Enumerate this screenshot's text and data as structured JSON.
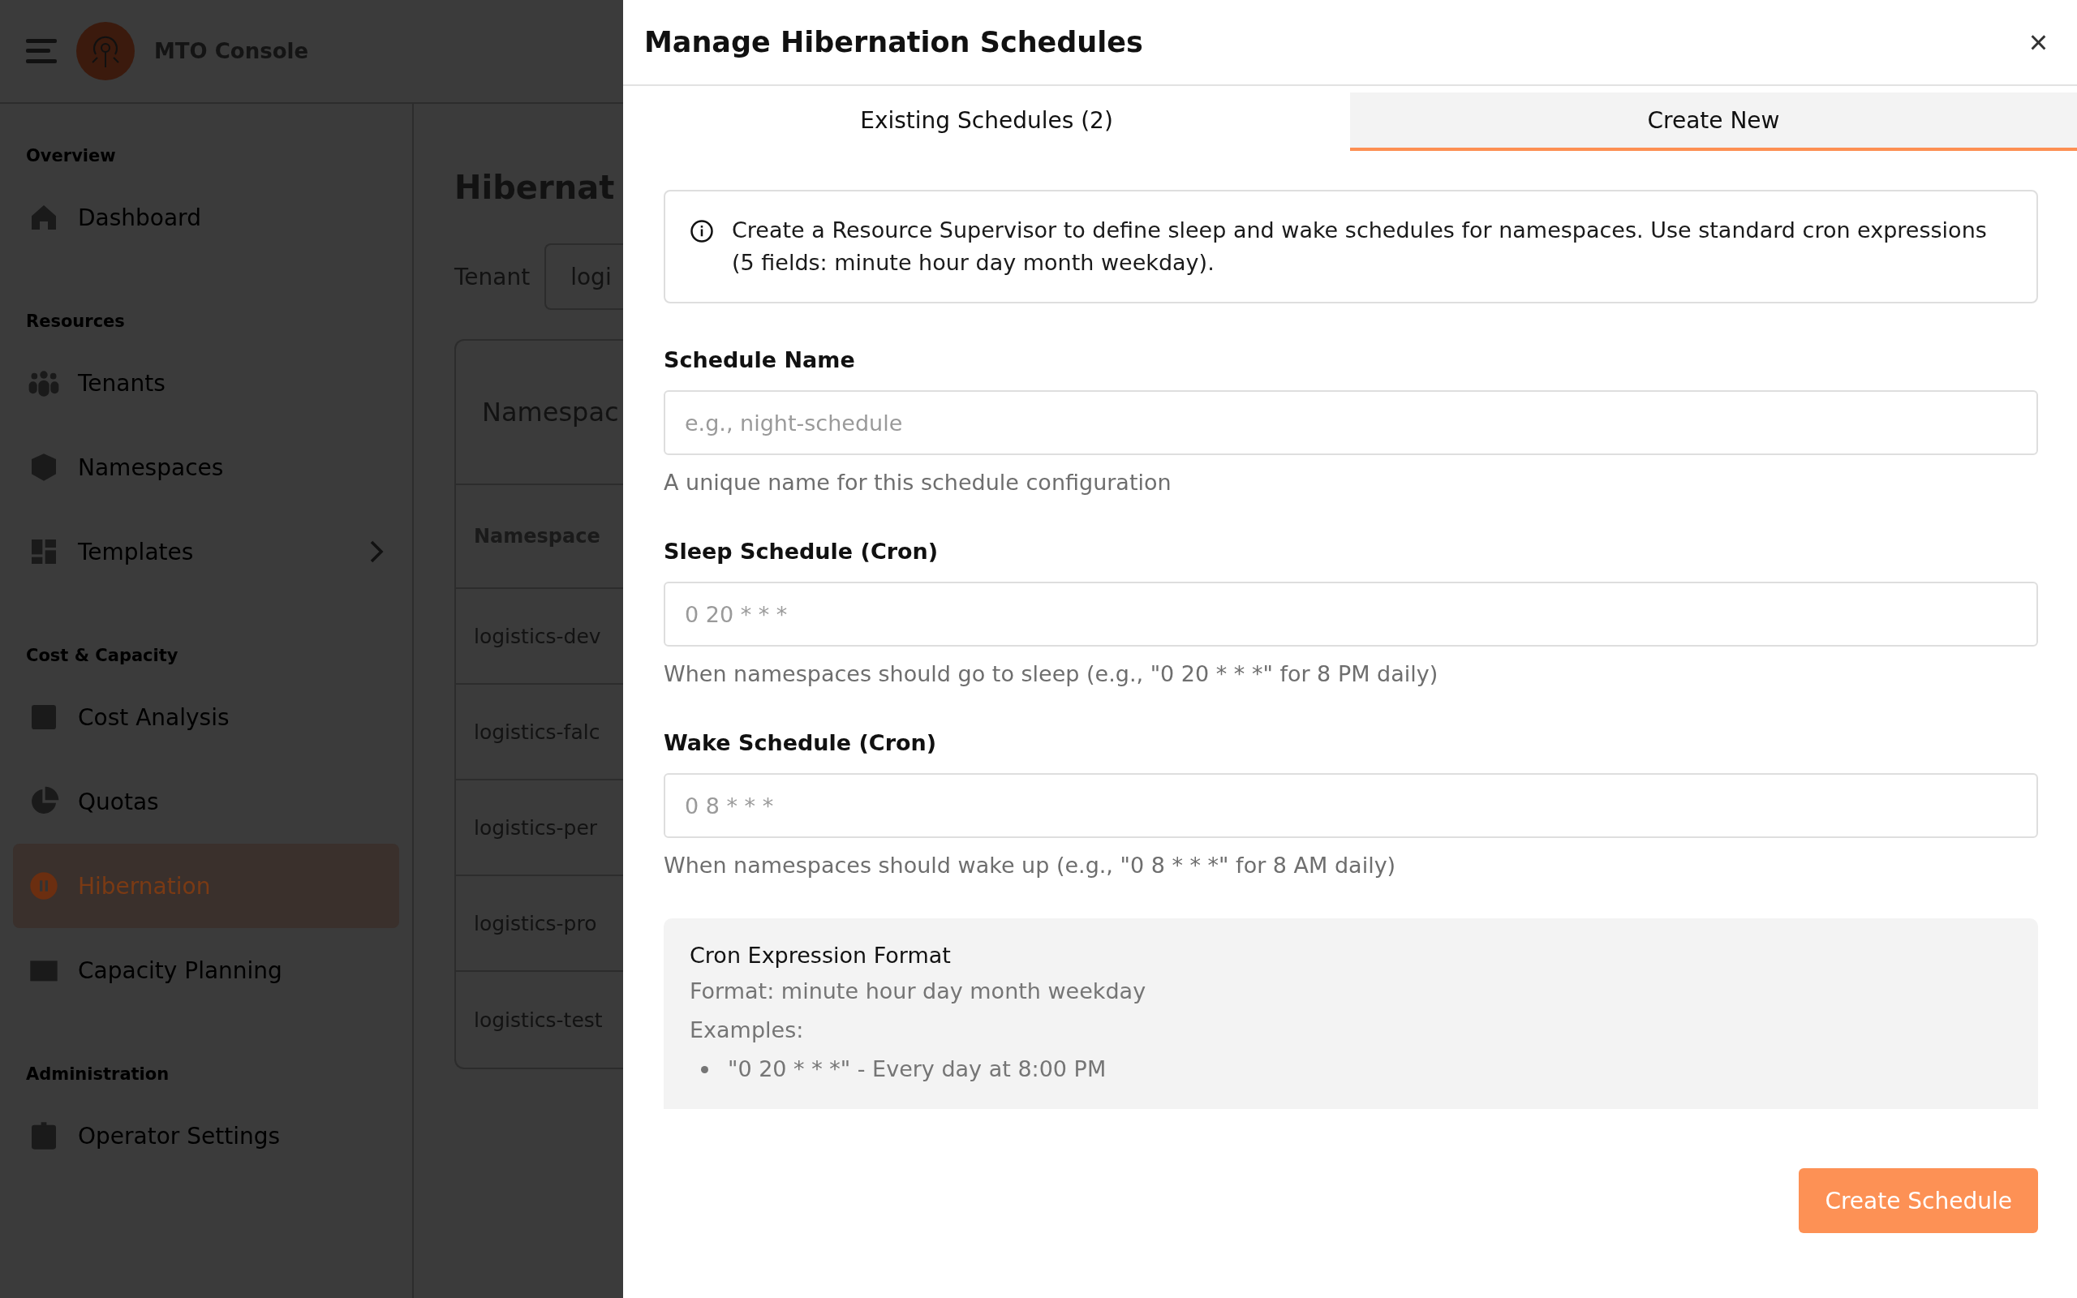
{
  "app": {
    "title": "MTO Console"
  },
  "sidebar": {
    "sections": [
      {
        "title": "Overview",
        "items": [
          {
            "label": "Dashboard",
            "selected": false,
            "kind": "link"
          }
        ]
      },
      {
        "title": "Resources",
        "items": [
          {
            "label": "Tenants",
            "selected": false,
            "kind": "link"
          },
          {
            "label": "Namespaces",
            "selected": false,
            "kind": "link"
          },
          {
            "label": "Templates",
            "selected": false,
            "kind": "group"
          }
        ]
      },
      {
        "title": "Cost & Capacity",
        "items": [
          {
            "label": "Cost Analysis",
            "selected": false,
            "kind": "link"
          },
          {
            "label": "Quotas",
            "selected": false,
            "kind": "link"
          },
          {
            "label": "Hibernation",
            "selected": true,
            "kind": "link"
          },
          {
            "label": "Capacity Planning",
            "selected": false,
            "kind": "link"
          }
        ]
      },
      {
        "title": "Administration",
        "items": [
          {
            "label": "Operator Settings",
            "selected": false,
            "kind": "link"
          }
        ]
      }
    ]
  },
  "page": {
    "title": "Hibernat",
    "tenant_label": "Tenant",
    "tenant_value": "logi",
    "card_title": "Namespac",
    "table": {
      "columns": [
        "Namespace"
      ],
      "rows": [
        "logistics-dev",
        "logistics-falc",
        "logistics-per",
        "logistics-pro",
        "logistics-test"
      ]
    }
  },
  "modal": {
    "title": "Manage Hibernation Schedules",
    "close": "×",
    "tabs": [
      {
        "label": "Existing Schedules (2)",
        "selected": false
      },
      {
        "label": "Create New",
        "selected": true
      }
    ],
    "info": "Create a Resource Supervisor to define sleep and wake schedules for namespaces. Use standard cron expressions (5 fields: minute hour day month weekday).",
    "fields": [
      {
        "label": "Schedule Name",
        "placeholder": "e.g., night-schedule",
        "help": "A unique name for this schedule configuration"
      },
      {
        "label": "Sleep Schedule (Cron)",
        "placeholder": "0 20 * * *",
        "help": "When namespaces should go to sleep (e.g., \"0 20 * * *\" for 8 PM daily)"
      },
      {
        "label": "Wake Schedule (Cron)",
        "placeholder": "0 8 * * *",
        "help": "When namespaces should wake up (e.g., \"0 8 * * *\" for 8 AM daily)"
      }
    ],
    "cron_help": {
      "title": "Cron Expression Format",
      "format": "Format: minute hour day month weekday",
      "examples_label": "Examples:",
      "examples": [
        "\"0 20 * * *\" - Every day at 8:00 PM"
      ]
    },
    "submit_button": "Create Schedule"
  }
}
